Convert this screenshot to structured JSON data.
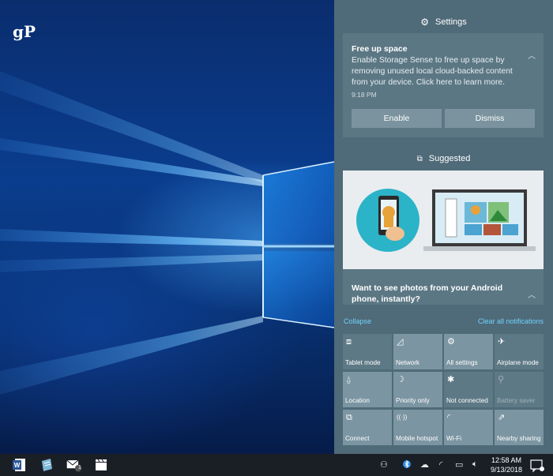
{
  "watermark": "gP",
  "action_center": {
    "header_label": "Settings",
    "notification": {
      "title": "Free up space",
      "body": "Enable Storage Sense to free up space by removing unused local cloud-backed content from your device. Click here to learn more.",
      "time": "9:18 PM",
      "enable_label": "Enable",
      "dismiss_label": "Dismiss"
    },
    "suggested": {
      "header_label": "Suggested",
      "title": "Want to see photos from your Android phone, instantly?"
    },
    "collapse_label": "Collapse",
    "clear_label": "Clear all notifications",
    "tiles": [
      {
        "label": "Tablet mode",
        "icon": "tablet-mode-icon",
        "state": "off"
      },
      {
        "label": "Network",
        "icon": "network-icon",
        "state": "on"
      },
      {
        "label": "All settings",
        "icon": "gear-icon",
        "state": "on"
      },
      {
        "label": "Airplane mode",
        "icon": "airplane-icon",
        "state": "off"
      },
      {
        "label": "Location",
        "icon": "location-icon",
        "state": "on"
      },
      {
        "label": "Priority only",
        "icon": "moon-icon",
        "state": "on"
      },
      {
        "label": "Not connected",
        "icon": "bluetooth-icon",
        "state": "off"
      },
      {
        "label": "Battery saver",
        "icon": "battery-saver-icon",
        "state": "disabled"
      },
      {
        "label": "Connect",
        "icon": "connect-icon",
        "state": "on"
      },
      {
        "label": "Mobile hotspot",
        "icon": "mobile-hotspot-icon",
        "state": "on"
      },
      {
        "label": "Wi-Fi",
        "icon": "wifi-icon",
        "state": "on"
      },
      {
        "label": "Nearby sharing",
        "icon": "nearby-sharing-icon",
        "state": "on"
      }
    ]
  },
  "taskbar": {
    "mail_badge": "1",
    "clock_time": "12:58 AM",
    "clock_date": "9/13/2018"
  },
  "colors": {
    "accent_link": "#6fd3ff",
    "tile_on": "#7b95a2",
    "tile_off": "#5e7986",
    "panel": "#4f6a78"
  }
}
